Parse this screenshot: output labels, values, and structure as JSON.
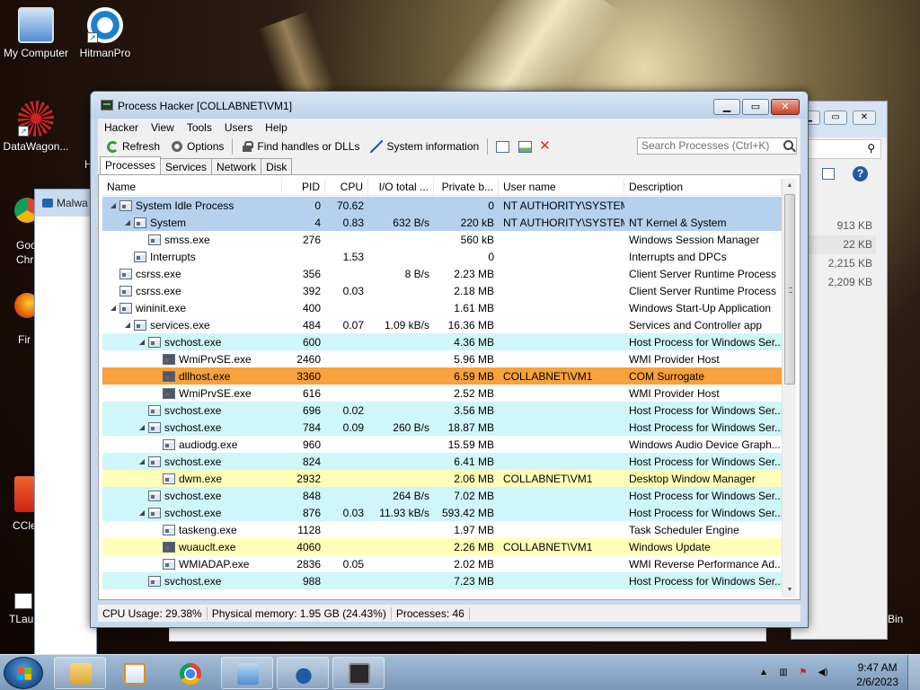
{
  "desktop": {
    "icons": [
      {
        "label": "My Computer"
      },
      {
        "label": "HitmanPro"
      },
      {
        "label": "DataWagon..."
      }
    ],
    "partial_labels": [
      "Goc",
      "Chr",
      "Fir",
      "CCle",
      "TLau",
      "H"
    ],
    "bg_window_title": "Malwa",
    "bg_window_values": [
      "913 KB",
      "22 KB",
      "2,215 KB",
      "2,209 KB"
    ],
    "recycle_label": "Bin"
  },
  "window": {
    "title": "Process Hacker [COLLABNET\\VM1]",
    "menu": [
      "Hacker",
      "View",
      "Tools",
      "Users",
      "Help"
    ],
    "toolbar": {
      "refresh": "Refresh",
      "options": "Options",
      "find_handles": "Find handles or DLLs",
      "system_info": "System information",
      "search_placeholder": "Search Processes (Ctrl+K)"
    },
    "tabs": [
      "Processes",
      "Services",
      "Network",
      "Disk"
    ],
    "columns": [
      "Name",
      "PID",
      "CPU",
      "I/O total ...",
      "Private b...",
      "User name",
      "Description"
    ],
    "rows": [
      {
        "name": "System Idle Process",
        "pid": "0",
        "cpu": "70.62",
        "io": "",
        "priv": "0",
        "user": "NT AUTHORITY\\SYSTEM",
        "desc": ""
      },
      {
        "name": "System",
        "pid": "4",
        "cpu": "0.83",
        "io": "632 B/s",
        "priv": "220 kB",
        "user": "NT AUTHORITY\\SYSTEM",
        "desc": "NT Kernel & System"
      },
      {
        "name": "smss.exe",
        "pid": "276",
        "cpu": "",
        "io": "",
        "priv": "560 kB",
        "user": "",
        "desc": "Windows Session Manager"
      },
      {
        "name": "Interrupts",
        "pid": "",
        "cpu": "1.53",
        "io": "",
        "priv": "0",
        "user": "",
        "desc": "Interrupts and DPCs"
      },
      {
        "name": "csrss.exe",
        "pid": "356",
        "cpu": "",
        "io": "8 B/s",
        "priv": "2.23 MB",
        "user": "",
        "desc": "Client Server Runtime Process"
      },
      {
        "name": "csrss.exe",
        "pid": "392",
        "cpu": "0.03",
        "io": "",
        "priv": "2.18 MB",
        "user": "",
        "desc": "Client Server Runtime Process"
      },
      {
        "name": "wininit.exe",
        "pid": "400",
        "cpu": "",
        "io": "",
        "priv": "1.61 MB",
        "user": "",
        "desc": "Windows Start-Up Application"
      },
      {
        "name": "services.exe",
        "pid": "484",
        "cpu": "0.07",
        "io": "1.09 kB/s",
        "priv": "16.36 MB",
        "user": "",
        "desc": "Services and Controller app"
      },
      {
        "name": "svchost.exe",
        "pid": "600",
        "cpu": "",
        "io": "",
        "priv": "4.36 MB",
        "user": "",
        "desc": "Host Process for Windows Ser..."
      },
      {
        "name": "WmiPrvSE.exe",
        "pid": "2460",
        "cpu": "",
        "io": "",
        "priv": "5.96 MB",
        "user": "",
        "desc": "WMI Provider Host"
      },
      {
        "name": "dllhost.exe",
        "pid": "3360",
        "cpu": "",
        "io": "",
        "priv": "6.59 MB",
        "user": "COLLABNET\\VM1",
        "desc": "COM Surrogate"
      },
      {
        "name": "WmiPrvSE.exe",
        "pid": "616",
        "cpu": "",
        "io": "",
        "priv": "2.52 MB",
        "user": "",
        "desc": "WMI Provider Host"
      },
      {
        "name": "svchost.exe",
        "pid": "696",
        "cpu": "0.02",
        "io": "",
        "priv": "3.56 MB",
        "user": "",
        "desc": "Host Process for Windows Ser..."
      },
      {
        "name": "svchost.exe",
        "pid": "784",
        "cpu": "0.09",
        "io": "260 B/s",
        "priv": "18.87 MB",
        "user": "",
        "desc": "Host Process for Windows Ser..."
      },
      {
        "name": "audiodg.exe",
        "pid": "960",
        "cpu": "",
        "io": "",
        "priv": "15.59 MB",
        "user": "",
        "desc": "Windows Audio Device Graph..."
      },
      {
        "name": "svchost.exe",
        "pid": "824",
        "cpu": "",
        "io": "",
        "priv": "6.41 MB",
        "user": "",
        "desc": "Host Process for Windows Ser..."
      },
      {
        "name": "dwm.exe",
        "pid": "2932",
        "cpu": "",
        "io": "",
        "priv": "2.06 MB",
        "user": "COLLABNET\\VM1",
        "desc": "Desktop Window Manager"
      },
      {
        "name": "svchost.exe",
        "pid": "848",
        "cpu": "",
        "io": "264 B/s",
        "priv": "7.02 MB",
        "user": "",
        "desc": "Host Process for Windows Ser..."
      },
      {
        "name": "svchost.exe",
        "pid": "876",
        "cpu": "0.03",
        "io": "11.93 kB/s",
        "priv": "593.42 MB",
        "user": "",
        "desc": "Host Process for Windows Ser..."
      },
      {
        "name": "taskeng.exe",
        "pid": "1128",
        "cpu": "",
        "io": "",
        "priv": "1.97 MB",
        "user": "",
        "desc": "Task Scheduler Engine"
      },
      {
        "name": "wuauclt.exe",
        "pid": "4060",
        "cpu": "",
        "io": "",
        "priv": "2.26 MB",
        "user": "COLLABNET\\VM1",
        "desc": "Windows Update"
      },
      {
        "name": "WMIADAP.exe",
        "pid": "2836",
        "cpu": "0.05",
        "io": "",
        "priv": "2.02 MB",
        "user": "",
        "desc": "WMI Reverse Performance Ad..."
      },
      {
        "name": "svchost.exe",
        "pid": "988",
        "cpu": "",
        "io": "",
        "priv": "7.23 MB",
        "user": "",
        "desc": "Host Process for Windows Ser..."
      }
    ],
    "status": {
      "cpu": "CPU Usage: 29.38%",
      "memory": "Physical memory: 1.95 GB (24.43%)",
      "processes": "Processes: 46"
    }
  },
  "taskbar": {
    "time": "9:47 AM",
    "date": "2/6/2023"
  },
  "colors": {
    "system_row": "#b5d1ee",
    "service_row": "#cff6f9",
    "selected_row": "#f7a23a",
    "own_process_row": "#ffffb9"
  }
}
